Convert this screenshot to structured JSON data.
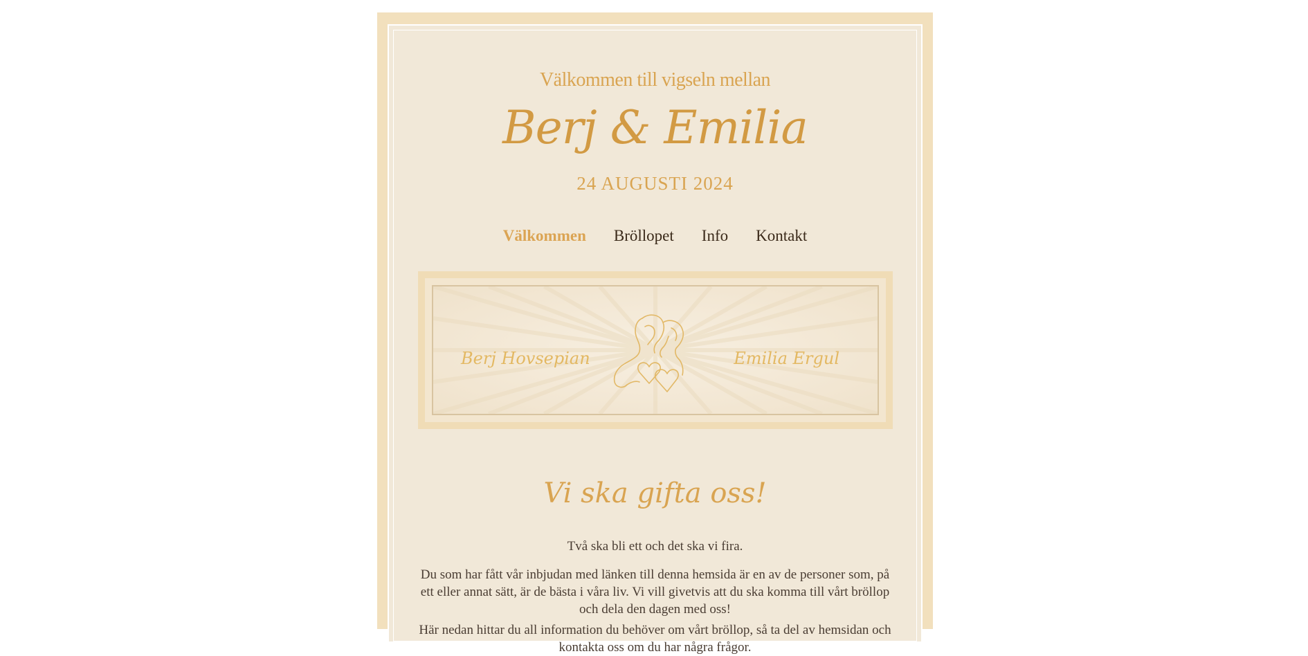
{
  "header": {
    "welcome_line": "Välkommen till vigseln mellan",
    "couple_names": "Berj & Emilia",
    "date": "24 AUGUSTI 2024"
  },
  "nav": {
    "items": [
      {
        "label": "Välkommen",
        "active": true
      },
      {
        "label": "Bröllopet",
        "active": false
      },
      {
        "label": "Info",
        "active": false
      },
      {
        "label": "Kontakt",
        "active": false
      }
    ]
  },
  "banner": {
    "name_left": "Berj Hovsepian",
    "name_right": "Emilia Ergul"
  },
  "main": {
    "title": "Vi ska gifta oss!",
    "paragraphs": [
      "Två ska bli ett och det ska vi fira.",
      "Du som har fått vår inbjudan med länken till denna hemsida är en av de personer som, på ett eller annat sätt, är de bästa i våra liv. Vi vill givetvis att du ska komma till vårt bröllop och dela den dagen med oss!",
      "Här nedan hittar du all information du behöver om vårt bröllop, så ta del av hemsidan och kontakta oss om du har några frågor."
    ]
  },
  "colors": {
    "accent_gold": "#d9a451",
    "frame_beige": "#f2e0bd",
    "background_cream": "#f1e8d8",
    "text_dark": "#3b2a1a"
  }
}
